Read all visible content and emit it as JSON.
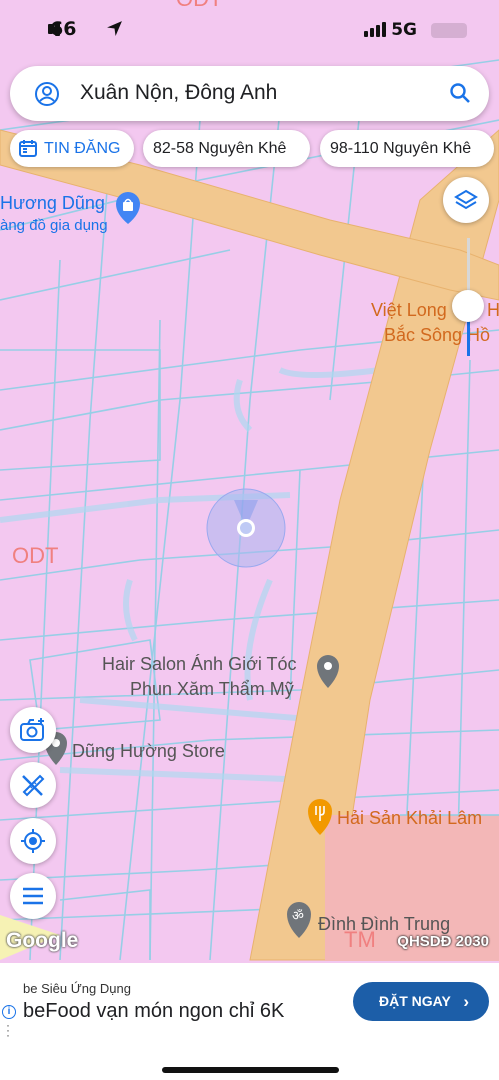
{
  "status_bar": {
    "time": "66",
    "network": "5G",
    "signal_bars": 4
  },
  "search": {
    "query": "Xuân Nộn, Đông Anh"
  },
  "chips": [
    {
      "label": "TIN ĐĂNG",
      "icon": "calendar-icon"
    },
    {
      "label": "82-58 Nguyên Khê"
    },
    {
      "label": "98-110 Nguyên Khê"
    }
  ],
  "map": {
    "zone_labels": [
      "ODT",
      "ODT",
      "TM"
    ],
    "pois": [
      {
        "name": "Hương Dũng",
        "sub": "àng đồ gia dụng",
        "icon": "shopping-bag-icon"
      },
      {
        "name": "Việt Long",
        "name_suffix": "H",
        "sub": "Bắc Sông Hồ"
      },
      {
        "name": "Hair Salon Ánh Giới Tóc",
        "sub": "Phun Xăm Thẩm Mỹ",
        "icon": "pin-icon"
      },
      {
        "name": "Dũng Hường Store",
        "icon": "pin-icon"
      },
      {
        "name": "Hải Sản Khải Lâm",
        "icon": "restaurant-icon"
      },
      {
        "name": "Đình Đình Trung",
        "icon": "temple-icon"
      }
    ]
  },
  "controls": {
    "layers": "layers-icon",
    "camera": "camera-add-icon",
    "measure": "ruler-pencil-icon",
    "locate": "my-location-icon",
    "menu": "menu-icon"
  },
  "attribution": {
    "google": "Google",
    "qh": "QHSDĐ 2030"
  },
  "ad": {
    "sponsor": "be Siêu Ứng Dụng",
    "headline": "beFood vạn món ngon chỉ 6K",
    "cta": "ĐẶT NGAY"
  },
  "colors": {
    "zone_fill": "#f3c8f0",
    "road": "#f2c88f",
    "accent": "#1a73e8",
    "cta": "#1c5ea8"
  }
}
